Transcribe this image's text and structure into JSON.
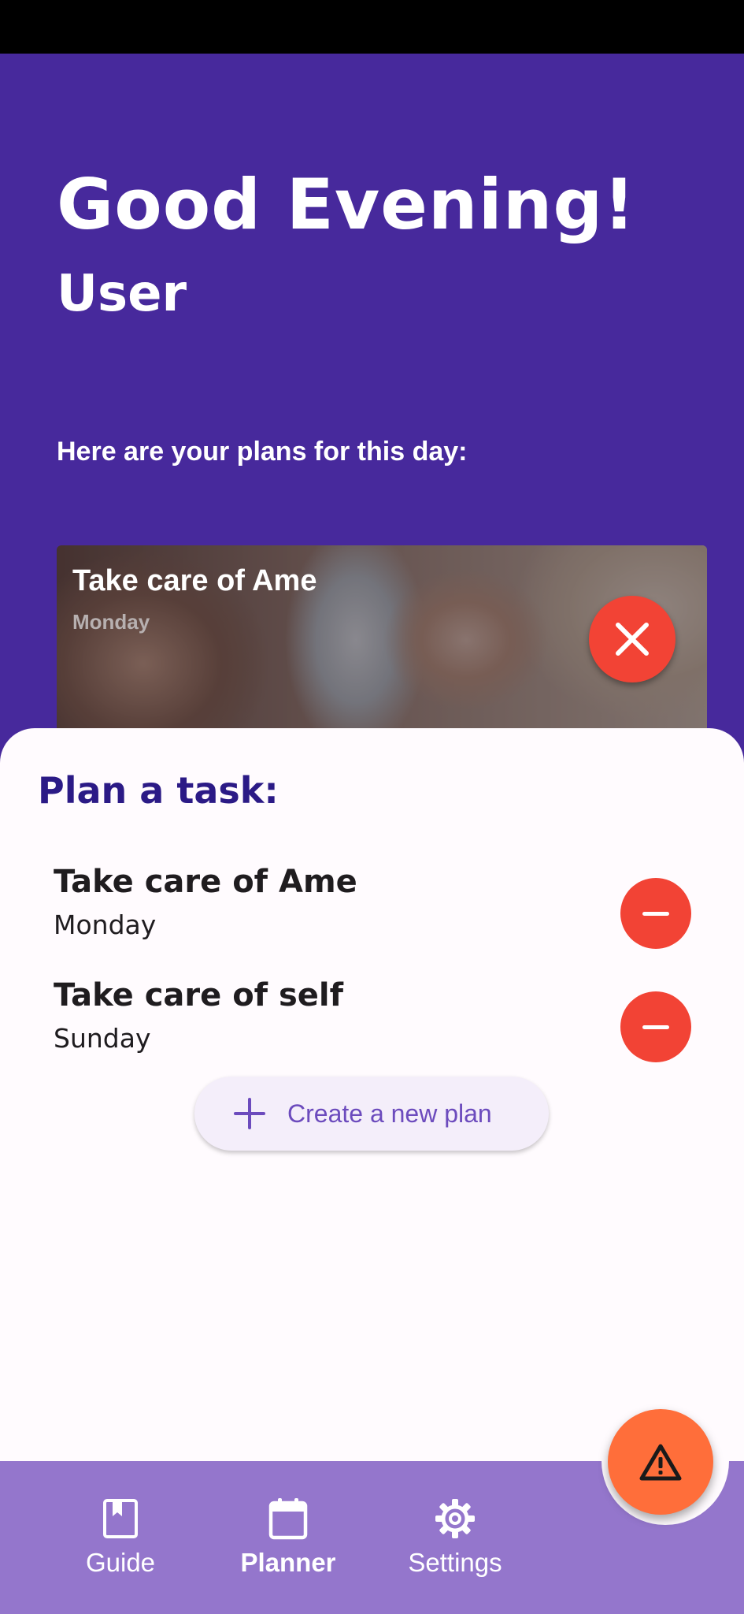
{
  "header": {
    "greeting": "Good Evening!",
    "user_name": "User",
    "plans_caption": "Here are your plans for this day:"
  },
  "today_plan": {
    "title": "Take care of Ame",
    "day": "Monday"
  },
  "plan_section": {
    "title": "Plan a task:",
    "tasks": [
      {
        "name": "Take care of Ame",
        "day": "Monday"
      },
      {
        "name": "Take care of self",
        "day": "Sunday"
      }
    ],
    "create_label": "Create a new plan"
  },
  "bottom_nav": {
    "items": [
      {
        "label": "Guide",
        "icon": "book-icon",
        "active": false
      },
      {
        "label": "Planner",
        "icon": "calendar-icon",
        "active": true
      },
      {
        "label": "Settings",
        "icon": "gear-icon",
        "active": false
      }
    ]
  },
  "fab": {
    "icon": "warning-icon"
  },
  "colors": {
    "header_bg": "#47299c",
    "accent_red": "#f24335",
    "sheet_title": "#2b1a86",
    "nav_bg": "#9476cc",
    "fab_orange": "#ff6e3a",
    "button_text": "#6c4bbd"
  }
}
